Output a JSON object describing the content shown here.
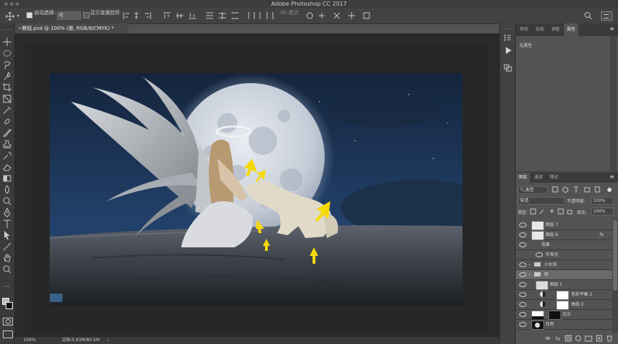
{
  "window": {
    "title": "Adobe Photoshop CC 2017"
  },
  "options_bar": {
    "auto_select_label": "自动选择:",
    "auto_select_value": "组",
    "show_transform_label": "显示变换控件",
    "mode_3d_label": "3D 模式:"
  },
  "document": {
    "tab_title": "教程.psd @ 100% (狼, RGB/8/CMYK) *",
    "zoom": "100%",
    "doc_size": "文档:5.93M/80.5M"
  },
  "properties_panel": {
    "tabs": [
      "颜色",
      "色板",
      "调整",
      "属性"
    ],
    "active_tab": "属性",
    "content": "无属性"
  },
  "layers_panel": {
    "tabs": [
      "图层",
      "通道",
      "路径"
    ],
    "active_tab": "图层",
    "filter_label": "类型",
    "blend_mode": "穿透",
    "opacity_label": "不透明度:",
    "opacity_value": "100%",
    "lock_label": "锁定:",
    "fill_label": "填充:",
    "fill_value": "100%",
    "layers": [
      {
        "name": "图层 7",
        "kind": "layer"
      },
      {
        "name": "图层 6",
        "kind": "layer",
        "fx": "fx"
      },
      {
        "name": "效果",
        "kind": "effect-header"
      },
      {
        "name": "外发光",
        "kind": "effect"
      },
      {
        "name": "小女孩",
        "kind": "group"
      },
      {
        "name": "狼",
        "kind": "group",
        "selected": true
      },
      {
        "name": "图层 1",
        "kind": "layer"
      },
      {
        "name": "色彩平衡 2",
        "kind": "adjustment"
      },
      {
        "name": "曲线 2",
        "kind": "adjustment"
      },
      {
        "name": "石头",
        "kind": "layer"
      },
      {
        "name": "月亮",
        "kind": "layer"
      }
    ]
  },
  "colors": {
    "accent_arrow": "#f5d90a",
    "ui_dark": "#3b3b3b",
    "ui_panel": "#424242",
    "selected_row": "#5d5d5d"
  }
}
